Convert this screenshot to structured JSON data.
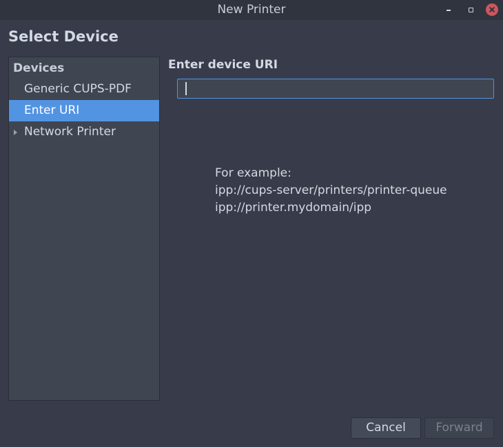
{
  "window": {
    "title": "New Printer"
  },
  "page": {
    "heading": "Select Device"
  },
  "devices": {
    "header": "Devices",
    "items": [
      {
        "label": "Generic CUPS-PDF",
        "selected": false,
        "expandable": false
      },
      {
        "label": "Enter URI",
        "selected": true,
        "expandable": false
      },
      {
        "label": "Network Printer",
        "selected": false,
        "expandable": true
      }
    ]
  },
  "uri": {
    "label": "Enter device URI",
    "value": "",
    "example_lines": [
      "For example:",
      "ipp://cups-server/printers/printer-queue",
      "ipp://printer.mydomain/ipp"
    ]
  },
  "buttons": {
    "cancel": "Cancel",
    "forward": "Forward"
  },
  "colors": {
    "background": "#383c4a",
    "accent": "#5294e2",
    "close": "#cc575d"
  }
}
